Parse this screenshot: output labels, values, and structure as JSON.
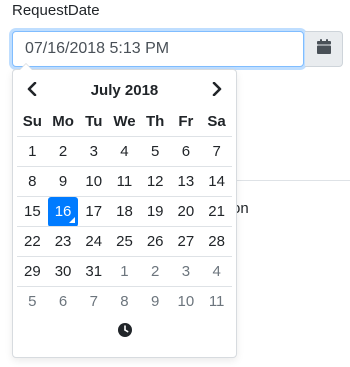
{
  "field": {
    "label": "RequestDate",
    "value": "07/16/2018 5:13 PM"
  },
  "background": {
    "partial_text": "on"
  },
  "datepicker": {
    "month_title": "July 2018",
    "weekdays": [
      "Su",
      "Mo",
      "Tu",
      "We",
      "Th",
      "Fr",
      "Sa"
    ],
    "weeks": [
      [
        "1",
        "2",
        "3",
        "4",
        "5",
        "6",
        "7"
      ],
      [
        "8",
        "9",
        "10",
        "11",
        "12",
        "13",
        "14"
      ],
      [
        "15",
        "16",
        "17",
        "18",
        "19",
        "20",
        "21"
      ],
      [
        "22",
        "23",
        "24",
        "25",
        "26",
        "27",
        "28"
      ],
      [
        "29",
        "30",
        "31",
        "1",
        "2",
        "3",
        "4"
      ],
      [
        "5",
        "6",
        "7",
        "8",
        "9",
        "10",
        "11"
      ]
    ],
    "selected_day": "16",
    "icons": {
      "prev": "chevron-left-icon",
      "next": "chevron-right-icon",
      "calendar": "calendar-icon",
      "time": "clock-icon"
    }
  },
  "colors": {
    "selected": "#007bff",
    "muted": "#6c757d",
    "focus_border": "#80bdff"
  }
}
